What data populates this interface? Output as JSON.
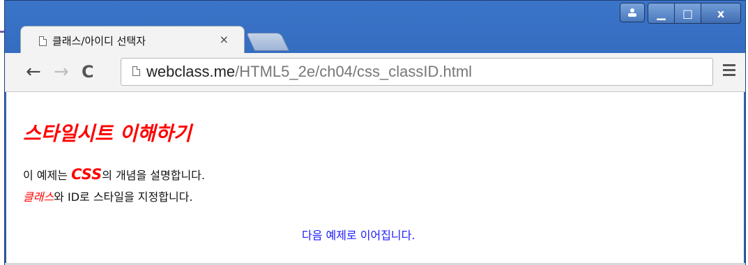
{
  "window": {
    "minimize_glyph": "▁",
    "maximize_glyph": "□",
    "close_glyph": "x"
  },
  "tab": {
    "title": "클래스/아이디 선택자",
    "close_glyph": "×"
  },
  "toolbar": {
    "back_glyph": "←",
    "forward_glyph": "→",
    "reload_glyph": "C",
    "url_host": "webclass.me",
    "url_path": "/HTML5_2e/ch04/css_classID.html"
  },
  "page": {
    "heading": "스타일시트 이해하기",
    "line1": {
      "before": "이 예제는 ",
      "em": "CSS",
      "after": "의 개념을 설명합니다."
    },
    "line2": {
      "em": "클래스",
      "after": "와 ID로 스타일을 지정합니다."
    },
    "next_link": "다음 예제로 이어집니다.",
    "colors": {
      "highlight": "#ff0000",
      "link": "#1a1aff"
    }
  }
}
